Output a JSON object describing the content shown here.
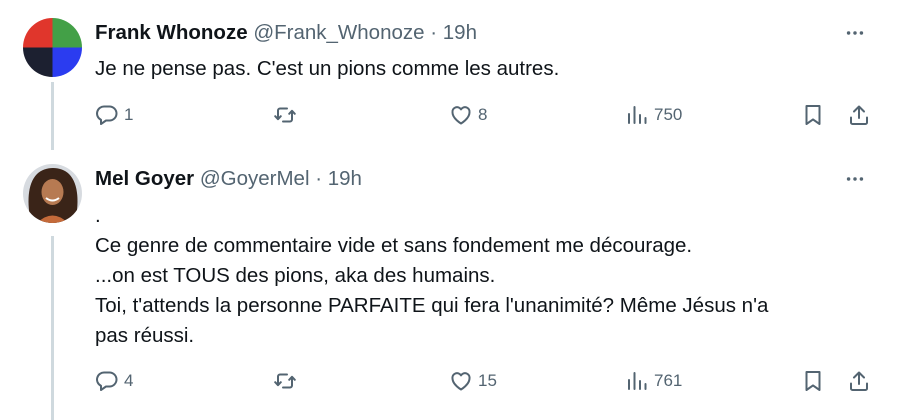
{
  "tweets": [
    {
      "name": "Frank Whonoze",
      "handle": "@Frank_Whonoze",
      "separator": "·",
      "time": "19h",
      "lines": [
        "Je ne pense pas. C'est un pions comme les autres."
      ],
      "replies": "1",
      "retweets": "",
      "likes": "8",
      "views": "750"
    },
    {
      "name": "Mel Goyer",
      "handle": "@GoyerMel",
      "separator": "·",
      "time": "19h",
      "lines": [
        ".",
        "Ce genre de commentaire vide et sans fondement me décourage.",
        "...on est TOUS des pions, aka des humains.",
        "Toi, t'attends la personne PARFAITE qui fera l'unanimité? Même Jésus n'a",
        "pas réussi."
      ],
      "replies": "4",
      "retweets": "",
      "likes": "15",
      "views": "761"
    }
  ],
  "colors": {
    "text": "#0f1419",
    "secondary": "#536471",
    "thread_line": "#cfd9de",
    "avatar_quadrants": [
      "#e0362c",
      "#43a047",
      "#1c2030",
      "#2b3cf0"
    ]
  },
  "icons": [
    "reply-icon",
    "retweet-icon",
    "like-icon",
    "views-icon",
    "bookmark-icon",
    "share-icon",
    "more-icon"
  ]
}
